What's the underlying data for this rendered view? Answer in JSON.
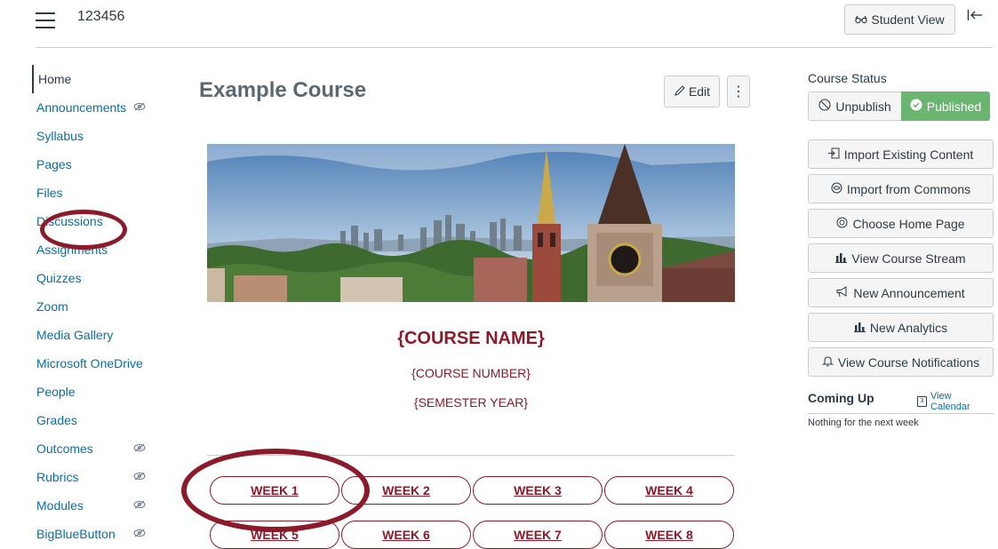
{
  "topbar": {
    "course_code": "123456",
    "student_view_label": "Student View"
  },
  "nav": {
    "items": [
      {
        "label": "Home",
        "active": true,
        "hidden": false
      },
      {
        "label": "Announcements",
        "active": false,
        "hidden": true
      },
      {
        "label": "Syllabus",
        "active": false,
        "hidden": false
      },
      {
        "label": "Pages",
        "active": false,
        "hidden": false
      },
      {
        "label": "Files",
        "active": false,
        "hidden": false
      },
      {
        "label": "Discussions",
        "active": false,
        "hidden": false
      },
      {
        "label": "Assignments",
        "active": false,
        "hidden": false
      },
      {
        "label": "Quizzes",
        "active": false,
        "hidden": false
      },
      {
        "label": "Zoom",
        "active": false,
        "hidden": false
      },
      {
        "label": "Media Gallery",
        "active": false,
        "hidden": false
      },
      {
        "label": "Microsoft OneDrive",
        "active": false,
        "hidden": false
      },
      {
        "label": "People",
        "active": false,
        "hidden": false
      },
      {
        "label": "Grades",
        "active": false,
        "hidden": false
      },
      {
        "label": "Outcomes",
        "active": false,
        "hidden": true
      },
      {
        "label": "Rubrics",
        "active": false,
        "hidden": true
      },
      {
        "label": "Modules",
        "active": false,
        "hidden": true
      },
      {
        "label": "BigBlueButton",
        "active": false,
        "hidden": true
      }
    ]
  },
  "main": {
    "title": "Example Course",
    "edit_label": "Edit",
    "more_label": "⋮",
    "course_name": "{COURSE NAME}",
    "course_number": "{COURSE NUMBER}",
    "semester_year": "{SEMESTER YEAR}",
    "weeks": [
      "WEEK 1",
      "WEEK 2",
      "WEEK 3",
      "WEEK 4",
      "WEEK 5",
      "WEEK 6",
      "WEEK 7",
      "WEEK 8"
    ]
  },
  "sidebar": {
    "status_title": "Course Status",
    "unpublish_label": "Unpublish",
    "published_label": "Published",
    "buttons": [
      {
        "label": "Import Existing Content",
        "icon": "import-icon"
      },
      {
        "label": "Import from Commons",
        "icon": "commons-icon"
      },
      {
        "label": "Choose Home Page",
        "icon": "home-page-icon"
      },
      {
        "label": "View Course Stream",
        "icon": "stream-icon"
      },
      {
        "label": "New Announcement",
        "icon": "megaphone-icon"
      },
      {
        "label": "New Analytics",
        "icon": "analytics-icon"
      },
      {
        "label": "View Course Notifications",
        "icon": "bell-icon"
      }
    ],
    "coming_up": "Coming Up",
    "view_calendar": "View Calendar",
    "calendar_icon_text": "3",
    "nothing_text": "Nothing for the next week"
  },
  "colors": {
    "accent": "#8b1a2a",
    "link": "#0770a3",
    "published": "#6ab56f"
  }
}
